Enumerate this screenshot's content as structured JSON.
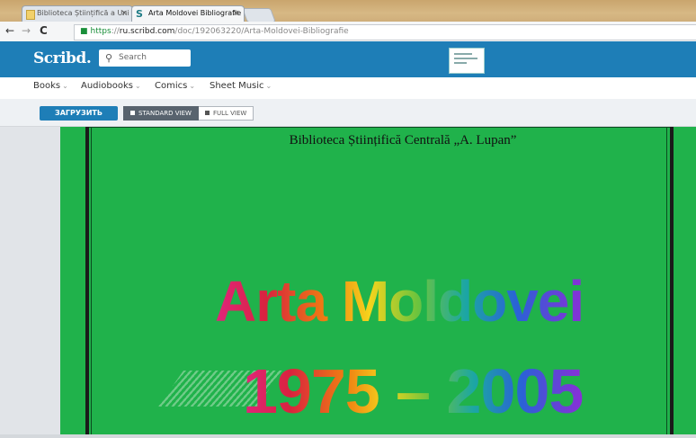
{
  "browser": {
    "tabs": [
      {
        "label": "Biblioteca Științifică a Uni",
        "active": false
      },
      {
        "label": "Arta Moldovei Bibliografie",
        "active": true
      }
    ],
    "close_glyph": "×",
    "url": {
      "proto": "https",
      "sep": "://",
      "host": "ru.scribd.com",
      "path": "/doc/192063220/Arta-Moldovei-Bibliografie"
    },
    "nav": {
      "back": "←",
      "forward": "→",
      "reload": "C"
    }
  },
  "header": {
    "logo": "Scribd.",
    "search_placeholder": "Search",
    "brand_color": "#1e7eb7"
  },
  "categories": [
    "Books",
    "Audiobooks",
    "Comics",
    "Sheet Music"
  ],
  "toolbar": {
    "upload_label": "ЗАГРУЗИТЬ",
    "standard_view_label": "STANDARD VIEW",
    "full_view_label": "FULL VIEW"
  },
  "document": {
    "library_line": "Biblioteca Științifică Centrală „A. Lupan”",
    "title": "Arta Moldovei",
    "years": "1975 – 2005",
    "page_color": "#20b24b"
  }
}
